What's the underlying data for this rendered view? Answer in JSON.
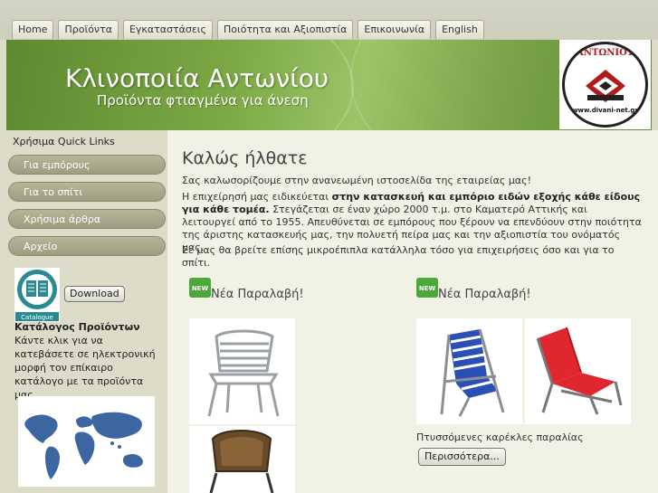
{
  "nav": {
    "items": [
      {
        "label": "Home"
      },
      {
        "label": "Προϊόντα"
      },
      {
        "label": "Εγκαταστάσεις"
      },
      {
        "label": "Ποιότητα και Αξιοπιστία"
      },
      {
        "label": "Επικοινωνία"
      },
      {
        "label": "English"
      }
    ]
  },
  "header": {
    "title": "Κλινοποιία Αντωνίου",
    "subtitle": "Προϊόντα φτιαγμένα για άνεση",
    "logo_text": "ΑΝΤΩΝΙΟΥ",
    "logo_url": "www.divani-net.gr"
  },
  "sidebar": {
    "quicklinks_title": "Χρήσιμα Quick Links",
    "items": [
      {
        "label": "Για εμπόρους"
      },
      {
        "label": "Για το σπίτι"
      },
      {
        "label": "Χρήσιμα άρθρα"
      },
      {
        "label": "Αρχείο"
      }
    ],
    "catalogue_icon_label": "Catalogue",
    "download_label": "Download",
    "catalogue_title": "Κατάλογος Προϊόντων",
    "catalogue_desc": "Κάντε κλικ για να κατεβάσετε σε ηλεκτρονική μορφή τον επίκαιρο κατάλογο με τα προϊόντα μας."
  },
  "content": {
    "welcome": "Καλώς ήλθατε",
    "intro": "Σας καλωσορίζουμε στην ανανεωμένη ιστοσελίδα της εταιρείας μας!",
    "p2_a": "Η επιχείρησή μας ειδικεύεται ",
    "p2_bold": "στην κατασκευή και εμπόριο ειδών εξοχής κάθε είδους για κάθε τομέα.",
    "p2_b": " Στεγάζεται σε έναν χώρο 2000 τ.μ. στο Καματερό Αττικής και λειτουργεί από το 1955. Απευθύνεται σε εμπόρους που ξέρουν να επενδύουν στην ποιότητα της άριστης κατασκευής μας, την πολυετή πείρα μας και την αξιοπιστία του ονόματός μας.",
    "p3": "Σε μας θα βρείτε επίσης μικροέπιπλα κατάλληλα τόσο για επιχειρήσεις όσο και για το σπίτι.",
    "promo_left_title": "Νέα Παραλαβή!",
    "promo_right_title": "Νέα Παραλαβή!",
    "new_badge": "NEW",
    "caption": "Πτυσσόμενες καρέκλες παραλίας",
    "more_label": "Περισσότερα..."
  },
  "colors": {
    "header_green": "#7ca845",
    "sidebar_button": "#a9a98d",
    "content_bg": "#f1f1e6",
    "beach_chair_red": "#e0262f",
    "beach_chair_blue": "#2a4fb5"
  }
}
